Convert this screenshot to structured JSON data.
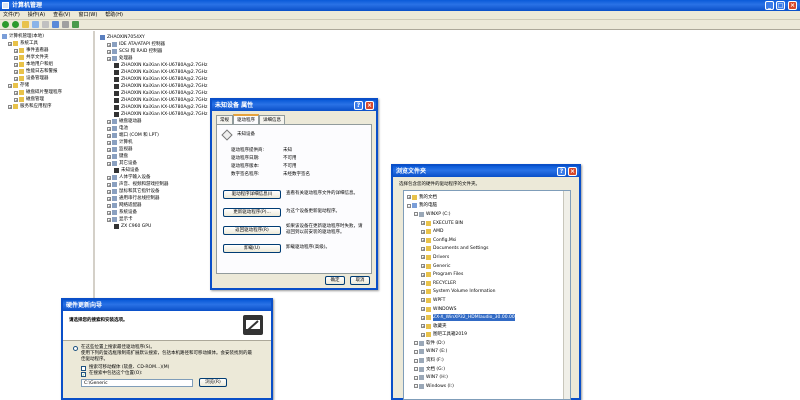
{
  "main_window": {
    "title": "计算机管理",
    "menu": [
      "文件(F)",
      "操作(A)",
      "查看(V)",
      "窗口(W)",
      "帮助(H)"
    ],
    "tree": [
      {
        "label": "计算机管理(本地)",
        "level": 0
      },
      {
        "label": "系统工具",
        "level": 1
      },
      {
        "label": "事件查看器",
        "level": 2
      },
      {
        "label": "共享文件夹",
        "level": 2
      },
      {
        "label": "本地用户和组",
        "level": 2
      },
      {
        "label": "性能日志和警报",
        "level": 2
      },
      {
        "label": "设备管理器",
        "level": 2
      },
      {
        "label": "存储",
        "level": 1
      },
      {
        "label": "磁盘碎片整理程序",
        "level": 2
      },
      {
        "label": "磁盘管理",
        "level": 2
      },
      {
        "label": "服务和应用程序",
        "level": 1
      }
    ],
    "devices": [
      {
        "label": "ZHAOXIN7054XY",
        "level": 0
      },
      {
        "label": "IDE ATA/ATAPI 控制器",
        "level": 1
      },
      {
        "label": "SCSI 和 RAID 控制器",
        "level": 1
      },
      {
        "label": "处理器",
        "level": 1
      },
      {
        "label": "ZHAOXIN KaiXian KX-U6780A@2.7GHz",
        "level": 2
      },
      {
        "label": "ZHAOXIN KaiXian KX-U6780A@2.7GHz",
        "level": 2
      },
      {
        "label": "ZHAOXIN KaiXian KX-U6780A@2.7GHz",
        "level": 2
      },
      {
        "label": "ZHAOXIN KaiXian KX-U6780A@2.7GHz",
        "level": 2
      },
      {
        "label": "ZHAOXIN KaiXian KX-U6780A@2.7GHz",
        "level": 2
      },
      {
        "label": "ZHAOXIN KaiXian KX-U6780A@2.7GHz",
        "level": 2
      },
      {
        "label": "ZHAOXIN KaiXian KX-U6780A@2.7GHz",
        "level": 2
      },
      {
        "label": "ZHAOXIN KaiXian KX-U6780A@2.7GHz",
        "level": 2
      },
      {
        "label": "磁盘驱动器",
        "level": 1
      },
      {
        "label": "电池",
        "level": 1
      },
      {
        "label": "端口 (COM 和 LPT)",
        "level": 1
      },
      {
        "label": "计算机",
        "level": 1
      },
      {
        "label": "监视器",
        "level": 1
      },
      {
        "label": "键盘",
        "level": 1
      },
      {
        "label": "其它设备",
        "level": 1
      },
      {
        "label": "未知设备",
        "level": 2
      },
      {
        "label": "人体学输入设备",
        "level": 1
      },
      {
        "label": "声音、视频和游戏控制器",
        "level": 1
      },
      {
        "label": "鼠标和其它指针设备",
        "level": 1
      },
      {
        "label": "通用串行总线控制器",
        "level": 1
      },
      {
        "label": "网络适配器",
        "level": 1
      },
      {
        "label": "系统设备",
        "level": 1
      },
      {
        "label": "显示卡",
        "level": 1
      },
      {
        "label": "ZX C960 GPU",
        "level": 2
      }
    ]
  },
  "props_dialog": {
    "title": "未知设备 属性",
    "tabs": [
      "常规",
      "驱动程序",
      "详细信息"
    ],
    "device_name": "未知设备",
    "info": [
      {
        "label": "驱动程序提供商:",
        "value": "未知"
      },
      {
        "label": "驱动程序日期:",
        "value": "不可用"
      },
      {
        "label": "驱动程序版本:",
        "value": "不可用"
      },
      {
        "label": "数字签名程序:",
        "value": "未经数字签名"
      }
    ],
    "actions": [
      {
        "button": "驱动程序详细信息(I)",
        "desc": "查看有关驱动程序文件的详细信息。"
      },
      {
        "button": "更新驱动程序(P)...",
        "desc": "为这个设备更新驱动程序。"
      },
      {
        "button": "返回驱动程序(R)",
        "desc": "如果该设备在更新驱动程序时失败，请返回到以前安装的驱动程序。"
      },
      {
        "button": "卸载(U)",
        "desc": "卸载驱动程序(高级)。"
      }
    ],
    "ok": "确定",
    "cancel": "取消"
  },
  "browse_dialog": {
    "title": "浏览文件夹",
    "instruction": "选择包含您的硬件的驱动程序的文件夹。",
    "tree": [
      {
        "label": "我的文档",
        "level": 0
      },
      {
        "label": "我的电脑",
        "level": 0
      },
      {
        "label": "WINXP (C:)",
        "level": 1
      },
      {
        "label": "EXECUTE BIN",
        "level": 2
      },
      {
        "label": "AMD",
        "level": 2
      },
      {
        "label": "Config.Msi",
        "level": 2
      },
      {
        "label": "Documents and Settings",
        "level": 2
      },
      {
        "label": "Drivers",
        "level": 2
      },
      {
        "label": "Generic",
        "level": 2
      },
      {
        "label": "Program Files",
        "level": 2
      },
      {
        "label": "RECYCLER",
        "level": 2
      },
      {
        "label": "System Volume Information",
        "level": 2
      },
      {
        "label": "WPFT",
        "level": 2
      },
      {
        "label": "WINDOWS",
        "level": 2
      },
      {
        "label": "ZX-X_WinXP32_HDMIaudio_30.00.00",
        "level": 2,
        "selected": true
      },
      {
        "label": "收藏夹",
        "level": 2
      },
      {
        "label": "图吧工具箱2019",
        "level": 2
      },
      {
        "label": "软件 (D:)",
        "level": 1
      },
      {
        "label": "WIN7 (E:)",
        "level": 1
      },
      {
        "label": "资料 (F:)",
        "level": 1
      },
      {
        "label": "文档 (G:)",
        "level": 1
      },
      {
        "label": "WIN7 (H:)",
        "level": 1
      },
      {
        "label": "Windows (I:)",
        "level": 1
      }
    ]
  },
  "wizard": {
    "title": "硬件更新向导",
    "heading": "请选择您的搜索和安装选项。",
    "option_text": "在这些位置上搜索最佳驱动程序(S)。",
    "option_desc": "使用下列的复选框限制或扩展默认搜索，包括本机路径和可移动媒体。会安装找到的最佳驱动程序。",
    "check1": "搜索可移动媒体 (软盘、CD-ROM...)(M)",
    "check2": "在搜索中包括这个位置(O):",
    "path": "C:\\Generic",
    "browse": "浏览(R)"
  }
}
